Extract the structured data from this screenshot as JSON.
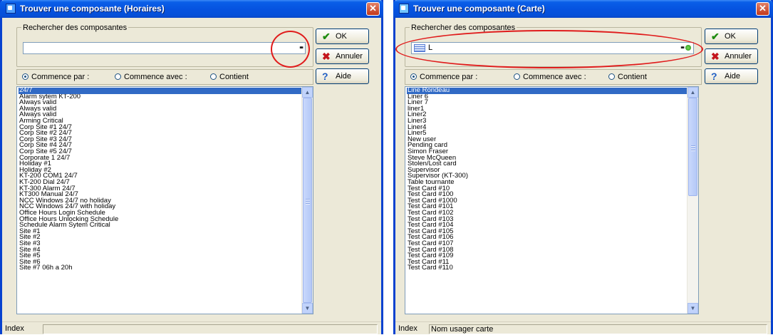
{
  "windows": [
    {
      "title": "Trouver une composante (Horaires)",
      "search_group_label": "Rechercher des composantes",
      "search_value": "",
      "buttons": {
        "ok": "OK",
        "cancel": "Annuler",
        "help": "Aide"
      },
      "radios": [
        "Commence par :",
        "Commence avec :",
        "Contient"
      ],
      "selected_radio": "Commence par :",
      "list_items": [
        "24/7",
        "Alarm sytem KT-200",
        "Always valid",
        "Always valid",
        "Always valid",
        "Arming Critical",
        "Corp Site #1 24/7",
        "Corp Site #2 24/7",
        "Corp Site #3 24/7",
        "Corp Site #4 24/7",
        "Corp Site #5 24/7",
        "Corporate 1 24/7",
        "Holiday #1",
        "Holiday #2",
        "KT-200  COM1 24/7",
        "KT-200 Dial  24/7",
        "KT-300 Alarm 24/7",
        "KT300 Manual 24/7",
        "NCC Windows 24/7 no holiday",
        "NCC Windows 24/7 with holiday",
        "Office Hours Login Schedule",
        "Office Hours Unlocking Schedule",
        "Schedule Alarm Sytem Critical",
        "Site #1",
        "Site #2",
        "Site #3",
        "Site #4",
        "Site #5",
        "Site #6",
        "Site #7 06h a 20h"
      ],
      "selected_item": "24/7",
      "status": {
        "left": "Index",
        "right": ""
      }
    },
    {
      "title": "Trouver une composante (Carte)",
      "search_group_label": "Rechercher des composantes",
      "search_value": "L",
      "buttons": {
        "ok": "OK",
        "cancel": "Annuler",
        "help": "Aide"
      },
      "radios": [
        "Commence par :",
        "Commence avec :",
        "Contient"
      ],
      "selected_radio": "Commence par :",
      "list_items": [
        "Line Rondeau",
        "Liner 6",
        "Liner 7",
        "liner1",
        "Liner2",
        "Liner3",
        "Liner4",
        "Liner5",
        "New user",
        "Pending card",
        "Simon Fraser",
        "Steve McQueen",
        "Stolen/Lost card",
        "Supervisor",
        "Supervisor (KT-300)",
        "Table tournante",
        "Test Card #10",
        "Test Card #100",
        "Test Card #1000",
        "Test Card #101",
        "Test Card #102",
        "Test Card #103",
        "Test Card #104",
        "Test Card #105",
        "Test Card #106",
        "Test Card #107",
        "Test Card #108",
        "Test Card #109",
        "Test Card #11",
        "Test Card #110"
      ],
      "selected_item": "Line Rondeau",
      "status": {
        "left": "Index",
        "right": "Nom usager carte"
      }
    }
  ],
  "colors": {
    "titlebar": "#0653e0",
    "dialog_bg": "#ece9d8",
    "selection": "#316ac5",
    "annotation_circle": "#e01c1c"
  },
  "icons": {
    "ok": "checkmark-icon",
    "cancel": "red-x-icon",
    "help": "question-icon",
    "search": "binoculars-icon"
  }
}
